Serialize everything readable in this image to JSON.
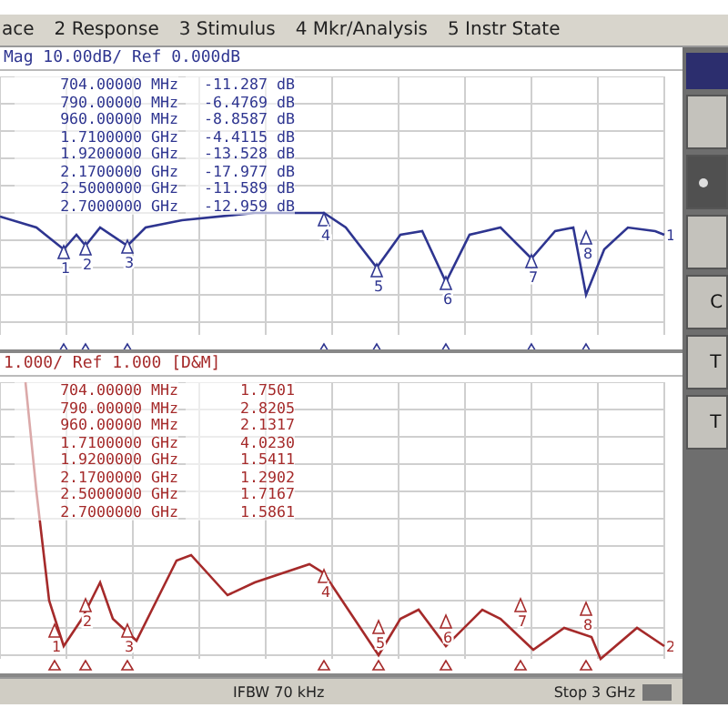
{
  "menu": [
    {
      "label": "ace"
    },
    {
      "label": "2 Response"
    },
    {
      "label": "3 Stimulus"
    },
    {
      "label": "4 Mkr/Analysis"
    },
    {
      "label": "5 Instr State"
    }
  ],
  "traces": [
    {
      "kind": "magnitude",
      "header": "Mag 10.00dB/ Ref 0.000dB",
      "color": "#2e3590",
      "end_label": "1",
      "markers": [
        {
          "label": "1"
        },
        {
          "label": "2"
        },
        {
          "label": "3"
        },
        {
          "label": "4"
        },
        {
          "label": "5"
        },
        {
          "label": "6"
        },
        {
          "label": "7"
        },
        {
          "label": "8"
        }
      ],
      "rows": [
        {
          "frequency": "704.00000 MHz",
          "value": "-11.287 dB"
        },
        {
          "frequency": "790.00000 MHz",
          "value": "-6.4769 dB"
        },
        {
          "frequency": "960.00000 MHz",
          "value": "-8.8587 dB"
        },
        {
          "frequency": "1.7100000 GHz",
          "value": "-4.4115 dB"
        },
        {
          "frequency": "1.9200000 GHz",
          "value": "-13.528 dB"
        },
        {
          "frequency": "2.1700000 GHz",
          "value": "-17.977 dB"
        },
        {
          "frequency": "2.5000000 GHz",
          "value": "-11.589 dB"
        },
        {
          "frequency": "2.7000000 GHz",
          "value": "-12.959 dB"
        }
      ]
    },
    {
      "kind": "swr",
      "header": "1.000/ Ref 1.000 [D&M]",
      "color": "#a52a2a",
      "end_label": "2",
      "markers": [
        {
          "label": "1"
        },
        {
          "label": "2"
        },
        {
          "label": "3"
        },
        {
          "label": "4"
        },
        {
          "label": "5"
        },
        {
          "label": "6"
        },
        {
          "label": "7"
        },
        {
          "label": "8"
        }
      ],
      "rows": [
        {
          "frequency": "704.00000 MHz",
          "value": "1.7501"
        },
        {
          "frequency": "790.00000 MHz",
          "value": "2.8205"
        },
        {
          "frequency": "960.00000 MHz",
          "value": "2.1317"
        },
        {
          "frequency": "1.7100000 GHz",
          "value": "4.0230"
        },
        {
          "frequency": "1.9200000 GHz",
          "value": "1.5411"
        },
        {
          "frequency": "2.1700000 GHz",
          "value": "1.2902"
        },
        {
          "frequency": "2.5000000 GHz",
          "value": "1.7167"
        },
        {
          "frequency": "2.7000000 GHz",
          "value": "1.5861"
        }
      ]
    }
  ],
  "status_bar": {
    "bandwidth": "IFBW 70 kHz",
    "stop": "Stop 3 GHz"
  },
  "softkeys": [
    {
      "kind": "header"
    },
    {
      "kind": "key"
    },
    {
      "kind": "radio"
    },
    {
      "kind": "key"
    },
    {
      "kind": "key",
      "label": "C"
    },
    {
      "kind": "key",
      "label": "T"
    },
    {
      "kind": "key",
      "label": "T"
    }
  ]
}
